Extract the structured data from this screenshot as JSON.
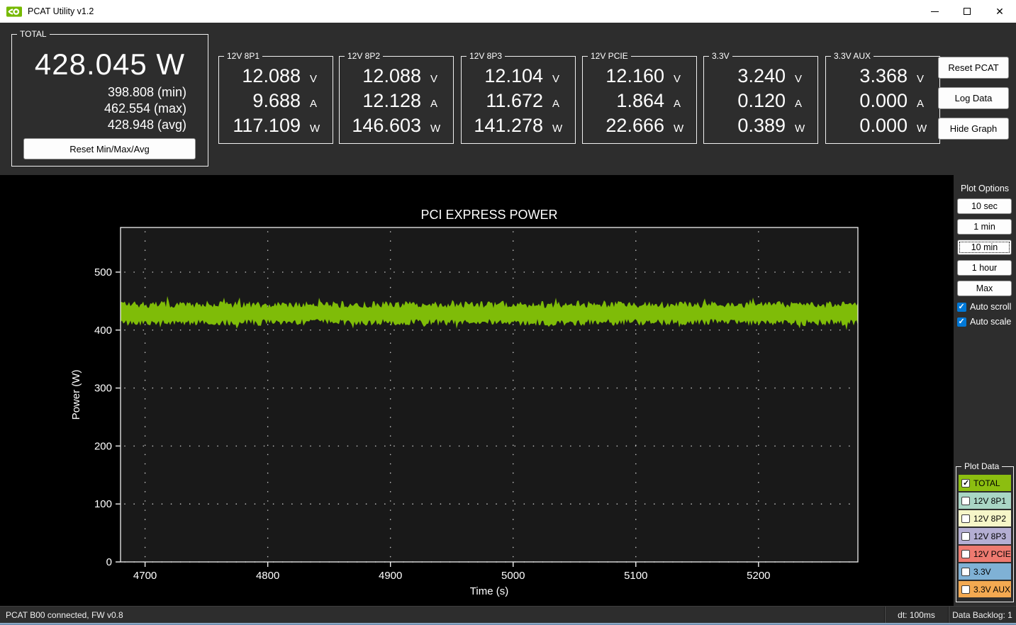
{
  "window": {
    "title": "PCAT Utility v1.2"
  },
  "icons": {
    "title_logo": "nvidia-logo",
    "minimize": "minimize-icon",
    "maximize": "maximize-icon",
    "close": "close-icon"
  },
  "total": {
    "label": "TOTAL",
    "value": "428.045 W",
    "min": "398.808 (min)",
    "max": "462.554 (max)",
    "avg": "428.948 (avg)",
    "reset": "Reset Min/Max/Avg"
  },
  "units": {
    "v": "V",
    "a": "A",
    "w": "W"
  },
  "rails": [
    {
      "label": "12V 8P1",
      "volts": "12.088",
      "amps": "9.688",
      "watts": "117.109"
    },
    {
      "label": "12V 8P2",
      "volts": "12.088",
      "amps": "12.128",
      "watts": "146.603"
    },
    {
      "label": "12V 8P3",
      "volts": "12.104",
      "amps": "11.672",
      "watts": "141.278"
    },
    {
      "label": "12V PCIE",
      "volts": "12.160",
      "amps": "1.864",
      "watts": "22.666"
    },
    {
      "label": "3.3V",
      "volts": "3.240",
      "amps": "0.120",
      "watts": "0.389"
    },
    {
      "label": "3.3V AUX",
      "volts": "3.368",
      "amps": "0.000",
      "watts": "0.000"
    }
  ],
  "actions": [
    "Reset PCAT",
    "Log Data",
    "Hide Graph"
  ],
  "plot_options": {
    "title": "Plot Options",
    "buttons": [
      "10 sec",
      "1 min",
      "10 min",
      "1 hour",
      "Max"
    ],
    "active_button": "10 min",
    "autoscroll": {
      "label": "Auto scroll",
      "checked": true
    },
    "autoscale": {
      "label": "Auto scale",
      "checked": true
    }
  },
  "plot_data": {
    "label": "Plot Data",
    "series": [
      {
        "label": "TOTAL",
        "color": "#8cbe10",
        "checked": true
      },
      {
        "label": "12V 8P1",
        "color": "#a9d6c5",
        "checked": false
      },
      {
        "label": "12V 8P2",
        "color": "#f6f6c8",
        "checked": false
      },
      {
        "label": "12V 8P3",
        "color": "#b4aed3",
        "checked": false
      },
      {
        "label": "12V PCIE",
        "color": "#ee7a70",
        "checked": false
      },
      {
        "label": "3.3V",
        "color": "#7fb1d5",
        "checked": false
      },
      {
        "label": "3.3V AUX",
        "color": "#f3a951",
        "checked": false
      }
    ]
  },
  "chart_data": {
    "type": "line",
    "title": "PCI EXPRESS POWER",
    "xlabel": "Time (s)",
    "ylabel": "Power (W)",
    "xlim": [
      4680,
      5281
    ],
    "ylim": [
      0,
      577
    ],
    "xticks": [
      4700,
      4800,
      4900,
      5000,
      5100,
      5200
    ],
    "yticks": [
      0,
      100,
      200,
      300,
      400,
      500
    ],
    "grid": "dotted",
    "legend_position": "none",
    "background": "#000000",
    "plot_background": "#191919",
    "series": [
      {
        "name": "TOTAL",
        "color": "#7fbc08",
        "style": "noisy-band",
        "mean": 428.948,
        "min": 398.808,
        "max": 462.554,
        "typical_low": 407,
        "typical_high": 450
      }
    ]
  },
  "status": {
    "left": "PCAT B00 connected, FW v0.8",
    "dt": "dt: 100ms",
    "backlog": "Data Backlog: 1"
  }
}
